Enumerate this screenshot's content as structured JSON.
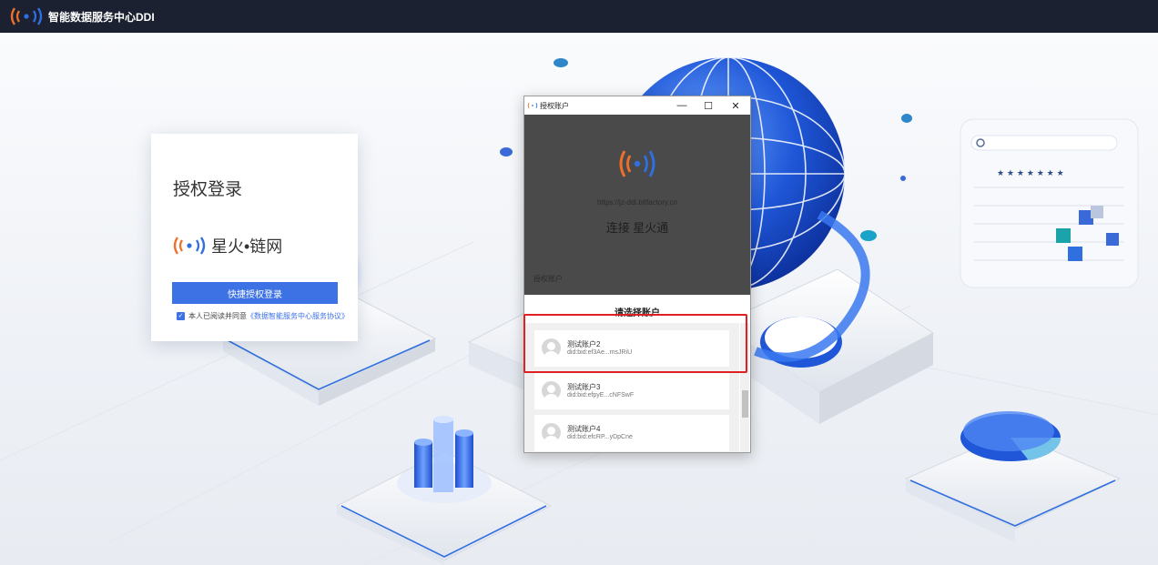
{
  "app": {
    "title": "智能数据服务中心DDI"
  },
  "login": {
    "title": "授权登录",
    "brand_name": "星火•链网",
    "button_label": "快捷授权登录",
    "agree_text": "本人已阅读并同意",
    "agree_link": "《数据智能服务中心服务协议》",
    "agree_checked": true
  },
  "popup": {
    "window_title": "授权账户",
    "controls": {
      "minimize": "—",
      "maximize": "☐",
      "close": "✕"
    },
    "url": "https://jz-ddi.bitfactory.cn",
    "connect_text": "连接 星火通",
    "section_label": "授权账户",
    "select_title": "请选择账户",
    "accounts": [
      {
        "name": "测试账户2",
        "did": "did:bid:ef3Ae...msJRiU",
        "selected": true
      },
      {
        "name": "测试账户3",
        "did": "did:bid:efpyE...cNFSwF",
        "selected": false
      },
      {
        "name": "测试账户4",
        "did": "did:bid:efcRP...yDpCne",
        "selected": false
      }
    ]
  },
  "colors": {
    "topbar": "#1b2130",
    "primary": "#3d72e4",
    "popup_dark": "#4a4a4a",
    "highlight": "#e02020",
    "logo_orange": "#f0702b",
    "logo_blue": "#2f6fe0"
  },
  "icons": {
    "logo": "signal-waves-icon",
    "avatar": "user-avatar-icon",
    "checkbox": "checkmark-icon"
  }
}
